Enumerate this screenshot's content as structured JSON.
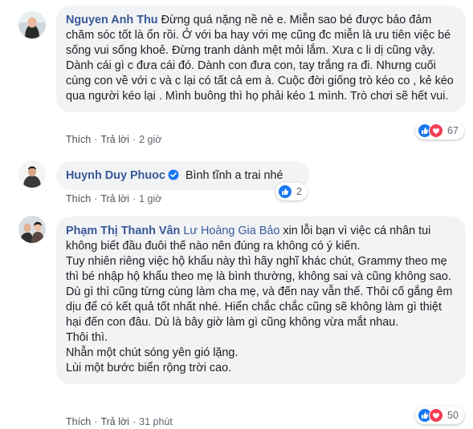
{
  "comments": [
    {
      "author": "Nguyen Anh Thu",
      "text": "Đừng quá nặng nề nè e. Miễn sao bé được bảo đảm chăm sóc tốt là ổn rồi. Ở với ba hay với mẹ cũng đc miễn là ưu tiên việc bé sống vui sống khoẻ. Đừng tranh dành mệt mỏi lắm. Xưa c li dị cũng vậy. Dành cái gì c đưa cái đó. Dành con đưa con, tay trắng ra đi. Nhưng cuối cùng con về với c và c lại có tất cả em à. Cuộc đời giống trò kéo co , kẻ kéo qua người kéo lại . Mình buông thì họ phải kéo 1 mình. Trò chơi sẽ hết vui.",
      "actions": {
        "like": "Thích",
        "reply": "Trả lời",
        "time": "2 giờ"
      },
      "reaction_count": "67",
      "reactions": [
        "like-icon",
        "love-icon"
      ]
    },
    {
      "author": "Huynh Duy Phuoc",
      "verified": true,
      "text": "Bình tĩnh a trai nhé",
      "actions": {
        "like": "Thích",
        "reply": "Trả lời",
        "time": "1 giờ"
      },
      "reaction_count": "2",
      "reactions": [
        "like-icon"
      ]
    },
    {
      "author": "Phạm Thị Thanh Vân",
      "tag": "Lư Hoàng Gia Bảo",
      "text_after_tag": " xin lỗi bạn vì việc cá nhân tui không biết đầu đuôi thế nào nên đúng ra không có ý kiến.",
      "paragraphs": [
        "Tuy nhiên riêng việc hộ khẩu này thì hãy nghĩ khác chút, Grammy theo mẹ thì bé nhập hộ khẩu theo mẹ là bình thường, không sai và cũng không sao.",
        "Dù gì thì cũng từng cùng làm cha mẹ, và đến nay vẫn thế. Thôi cố gắng êm dịu để có kết quả tốt nhất nhé. Hiển chắc chắc cũng sẽ không làm gì thiệt hại đến con đâu. Dù là bây giờ làm gì cũng không vừa mắt nhau.",
        "Thôi thì.",
        "Nhẫn một chút sóng yên gió lặng.",
        "Lùi một bước biển rộng trời cao."
      ],
      "actions": {
        "like": "Thích",
        "reply": "Trả lời",
        "time": "31 phút"
      },
      "reaction_count": "50",
      "reactions": [
        "like-icon",
        "love-icon"
      ]
    }
  ],
  "colors": {
    "name": "#385898",
    "bubble": "#f2f3f5",
    "like": "#1877f2",
    "love": "#f33e58",
    "meta": "#606770"
  }
}
